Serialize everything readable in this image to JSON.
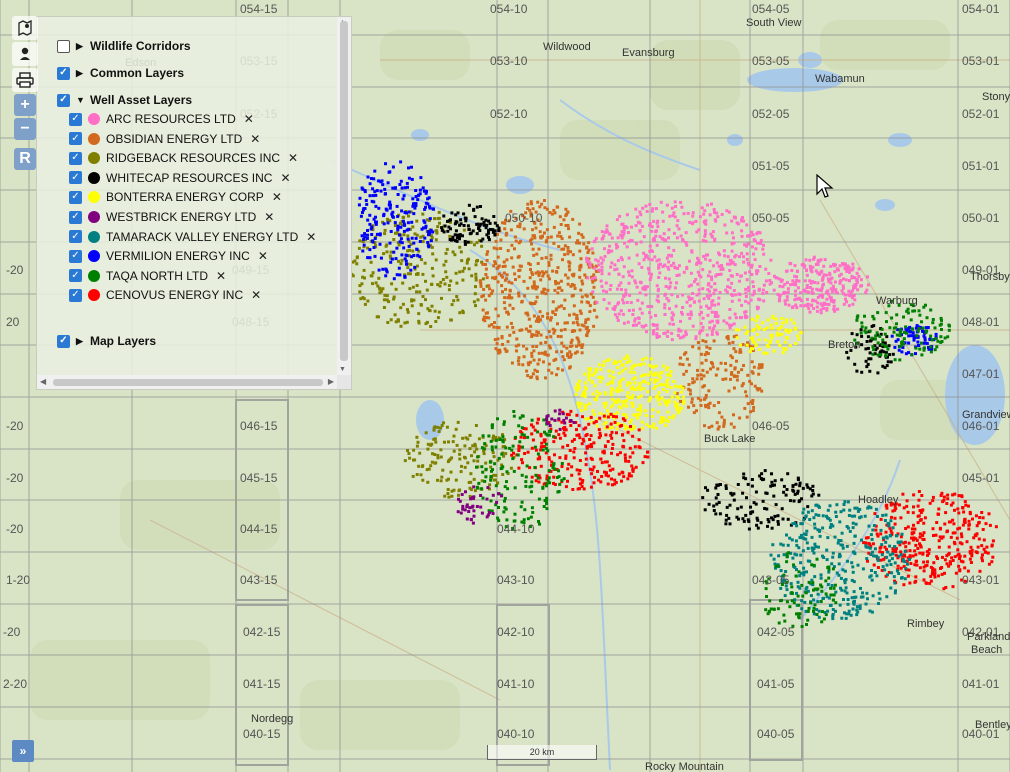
{
  "layer_panel": {
    "top_groups": [
      {
        "label": "Wildlife Corridors",
        "checked": false,
        "expanded": false
      },
      {
        "label": "Common Layers",
        "checked": true,
        "expanded": false
      },
      {
        "label": "Well Asset Layers",
        "checked": true,
        "expanded": true
      }
    ],
    "well_layers": [
      {
        "label": "ARC RESOURCES LTD",
        "color": "#ff6ec7"
      },
      {
        "label": "OBSIDIAN ENERGY LTD",
        "color": "#d2691e"
      },
      {
        "label": "RIDGEBACK RESOURCES INC",
        "color": "#808000"
      },
      {
        "label": "WHITECAP RESOURCES INC",
        "color": "#000000"
      },
      {
        "label": "BONTERRA ENERGY CORP",
        "color": "#ffff00"
      },
      {
        "label": "WESTBRICK ENERGY LTD",
        "color": "#800080"
      },
      {
        "label": "TAMARACK VALLEY ENERGY LTD",
        "color": "#008080"
      },
      {
        "label": "VERMILION ENERGY INC",
        "color": "#0000ff"
      },
      {
        "label": "TAQA NORTH LTD",
        "color": "#008000"
      },
      {
        "label": "CENOVUS ENERGY INC",
        "color": "#ff0000"
      }
    ],
    "map_layers": {
      "label": "Map Layers",
      "checked": true
    },
    "remove_glyph": "✕"
  },
  "toolbar": {
    "map_icon": "map-icon",
    "locate_icon": "location-pin-icon",
    "print_icon": "print-icon",
    "zoom_in": "+",
    "zoom_out": "−",
    "reset": "R"
  },
  "expand_button": "»",
  "scale_bar": "20 km",
  "places": {
    "edson": "Edson",
    "wildwood": "Wildwood",
    "evansburg": "Evansburg",
    "south_view": "South View",
    "wabamun": "Wabamun",
    "stony": "Stony",
    "warburg": "Warburg",
    "thorsby": "Thorsby",
    "breton": "Breton",
    "buck_lake": "Buck Lake",
    "grandview": "Grandview",
    "hoadley": "Hoadley",
    "rimbey": "Rimbey",
    "parkland_beach": "Parkland Beach",
    "bentley": "Bentley",
    "nordegg": "Nordegg",
    "rocky_mountain": "Rocky Mountain"
  },
  "grid_labels": [
    "054-15",
    "054-10",
    "054-05",
    "054-01",
    "053-15",
    "053-10",
    "053-05",
    "053-01",
    "052-15",
    "052-10",
    "052-05",
    "052-01",
    "051-05",
    "051-01",
    "050-10",
    "050-05",
    "050-01",
    "049-15",
    "049-01",
    "048-15",
    "048-01",
    "047-01",
    "046-15",
    "046-05",
    "046-01",
    "045-15",
    "045-01",
    "044-15",
    "044-10",
    "043-15",
    "043-10",
    "043-05",
    "043-01",
    "042-15",
    "042-10",
    "042-05",
    "042-01",
    "041-15",
    "041-10",
    "041-05",
    "041-01",
    "040-15",
    "040-10",
    "040-05",
    "040-01",
    "-20",
    "-20",
    "-20",
    "-20",
    "2-20",
    "1-20",
    "-20",
    "20",
    "20"
  ],
  "colors": {
    "map_bg": "#d9e4c6",
    "water": "#a9c9e8",
    "grid": "#9a9a9a",
    "ui_blue": "#7fa0c9"
  }
}
